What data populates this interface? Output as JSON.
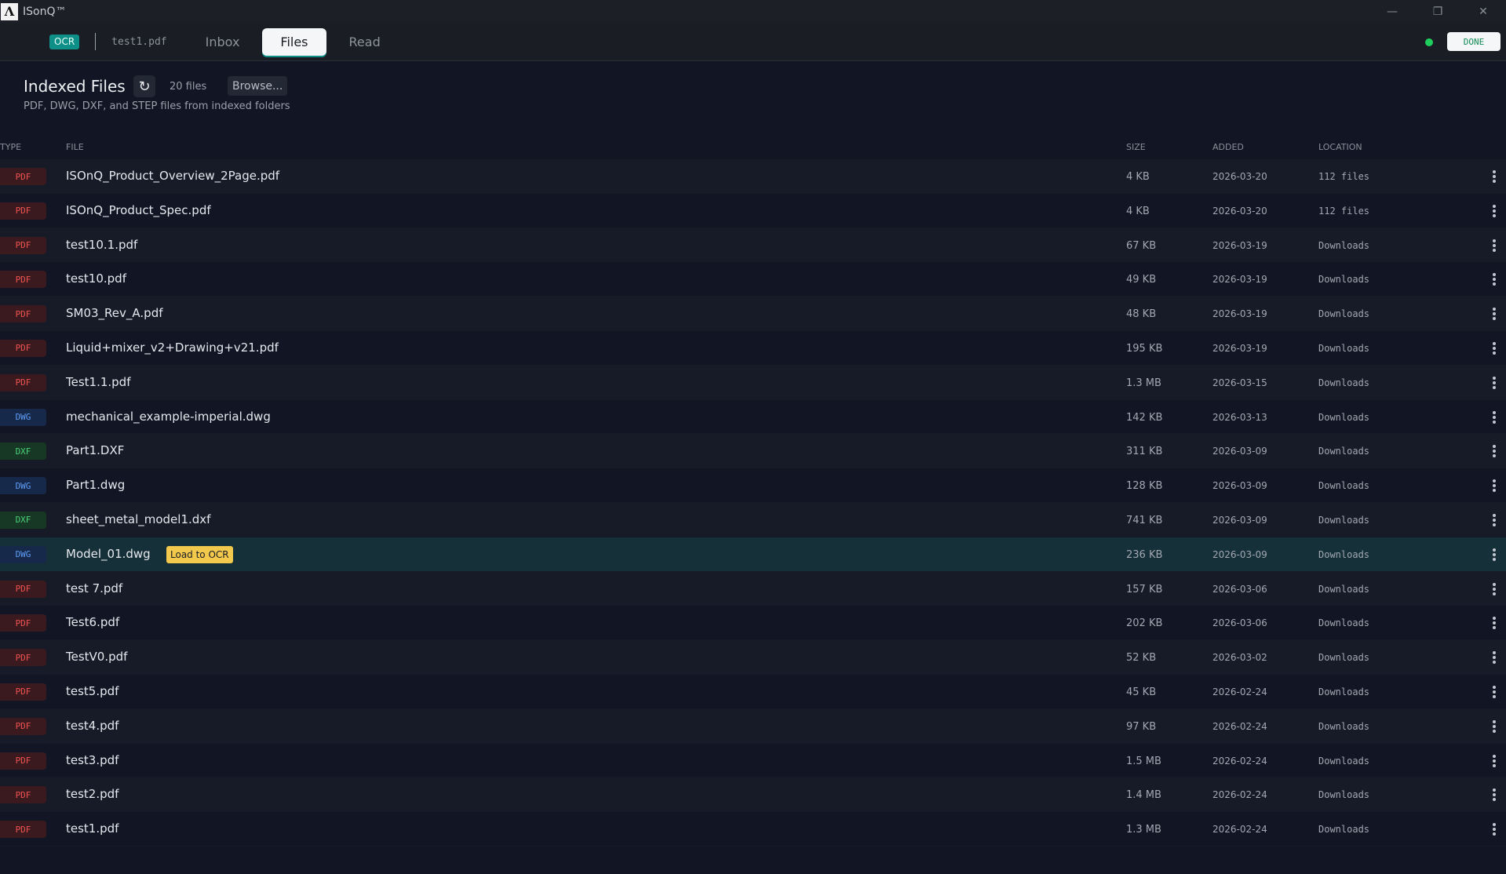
{
  "app": {
    "logo": "ISONQ",
    "title": "ISonQ™"
  },
  "window_controls": {
    "minimize": "—",
    "restore": "❐",
    "close": "✕"
  },
  "toolbar": {
    "ocr_badge": "OCR",
    "current_file": "test1.pdf",
    "tabs": [
      {
        "label": "Inbox",
        "active": false
      },
      {
        "label": "Files",
        "active": true
      },
      {
        "label": "Read",
        "active": false
      }
    ],
    "status_color": "#1fcf5c",
    "done_label": "DONE"
  },
  "header": {
    "title": "Indexed Files",
    "refresh_icon": "↻",
    "file_count": "20 files",
    "browse_label": "Browse...",
    "subtitle": "PDF, DWG, DXF, and STEP files from indexed folders"
  },
  "table": {
    "columns": {
      "type": "TYPE",
      "file": "FILE",
      "size": "SIZE",
      "added": "ADDED",
      "location": "LOCATION"
    },
    "load_to_ocr_label": "Load to OCR",
    "rows": [
      {
        "type": "PDF",
        "name": "ISOnQ_Product_Overview_2Page.pdf",
        "size": "4 KB",
        "added": "2026-03-20",
        "location": "112 files"
      },
      {
        "type": "PDF",
        "name": "ISOnQ_Product_Spec.pdf",
        "size": "4 KB",
        "added": "2026-03-20",
        "location": "112 files"
      },
      {
        "type": "PDF",
        "name": "test10.1.pdf",
        "size": "67 KB",
        "added": "2026-03-19",
        "location": "Downloads"
      },
      {
        "type": "PDF",
        "name": "test10.pdf",
        "size": "49 KB",
        "added": "2026-03-19",
        "location": "Downloads"
      },
      {
        "type": "PDF",
        "name": "SM03_Rev_A.pdf",
        "size": "48 KB",
        "added": "2026-03-19",
        "location": "Downloads"
      },
      {
        "type": "PDF",
        "name": "Liquid+mixer_v2+Drawing+v21.pdf",
        "size": "195 KB",
        "added": "2026-03-19",
        "location": "Downloads"
      },
      {
        "type": "PDF",
        "name": "Test1.1.pdf",
        "size": "1.3 MB",
        "added": "2026-03-15",
        "location": "Downloads"
      },
      {
        "type": "DWG",
        "name": "mechanical_example-imperial.dwg",
        "size": "142 KB",
        "added": "2026-03-13",
        "location": "Downloads"
      },
      {
        "type": "DXF",
        "name": "Part1.DXF",
        "size": "311 KB",
        "added": "2026-03-09",
        "location": "Downloads"
      },
      {
        "type": "DWG",
        "name": "Part1.dwg",
        "size": "128 KB",
        "added": "2026-03-09",
        "location": "Downloads"
      },
      {
        "type": "DXF",
        "name": "sheet_metal_model1.dxf",
        "size": "741 KB",
        "added": "2026-03-09",
        "location": "Downloads"
      },
      {
        "type": "DWG",
        "name": "Model_01.dwg",
        "size": "236 KB",
        "added": "2026-03-09",
        "location": "Downloads",
        "selected": true
      },
      {
        "type": "PDF",
        "name": "test 7.pdf",
        "size": "157 KB",
        "added": "2026-03-06",
        "location": "Downloads"
      },
      {
        "type": "PDF",
        "name": "Test6.pdf",
        "size": "202 KB",
        "added": "2026-03-06",
        "location": "Downloads"
      },
      {
        "type": "PDF",
        "name": "TestV0.pdf",
        "size": "52 KB",
        "added": "2026-03-02",
        "location": "Downloads"
      },
      {
        "type": "PDF",
        "name": "test5.pdf",
        "size": "45 KB",
        "added": "2026-02-24",
        "location": "Downloads"
      },
      {
        "type": "PDF",
        "name": "test4.pdf",
        "size": "97 KB",
        "added": "2026-02-24",
        "location": "Downloads"
      },
      {
        "type": "PDF",
        "name": "test3.pdf",
        "size": "1.5 MB",
        "added": "2026-02-24",
        "location": "Downloads"
      },
      {
        "type": "PDF",
        "name": "test2.pdf",
        "size": "1.4 MB",
        "added": "2026-02-24",
        "location": "Downloads"
      },
      {
        "type": "PDF",
        "name": "test1.pdf",
        "size": "1.3 MB",
        "added": "2026-02-24",
        "location": "Downloads"
      }
    ]
  }
}
